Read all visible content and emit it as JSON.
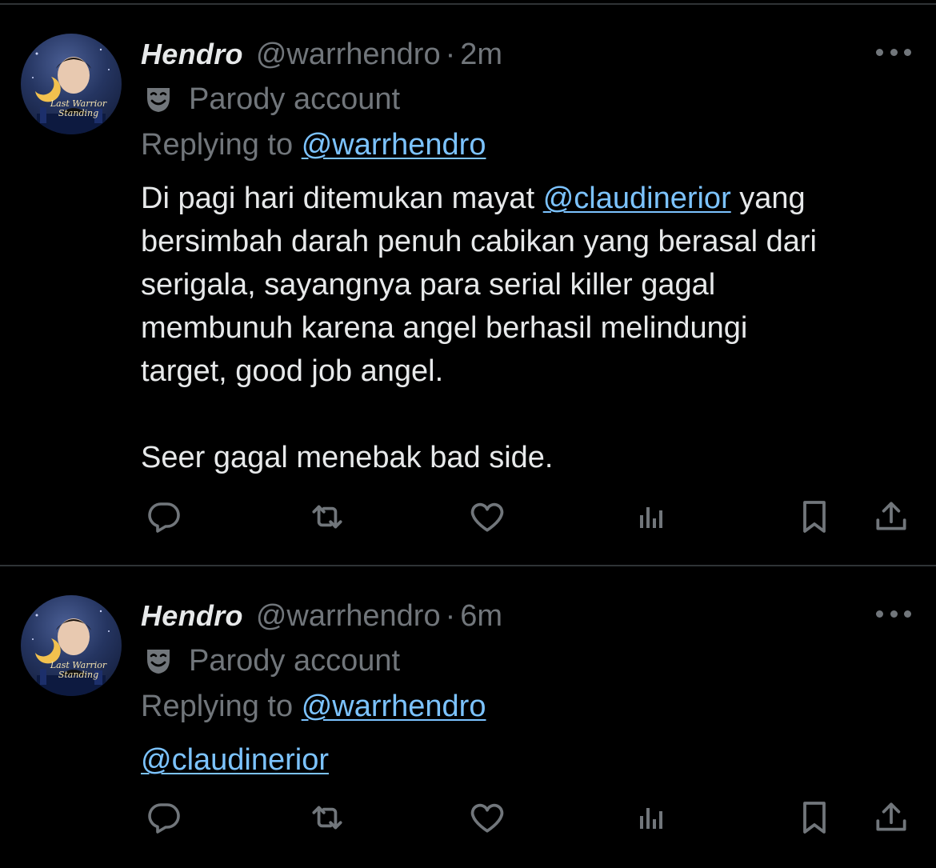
{
  "tweets": [
    {
      "author_name": "Hendro",
      "author_handle": "@warrhendro",
      "time": "2m",
      "parody_label": "Parody account",
      "replying_prefix": "Replying to",
      "replying_to": "@warrhendro",
      "body": {
        "line1_a": "Di pagi hari ditemukan mayat",
        "line1_mention": "@claudinerior",
        "line1_b": "yang",
        "line2": "bersimbah darah penuh cabikan yang berasal dari",
        "line3": "serigala, sayangnya para serial killer gagal",
        "line4": "membunuh karena angel berhasil melindungi",
        "line5": "target, good job angel.",
        "line6": "Seer gagal menebak bad side."
      },
      "avatar_text": "Last Warrior Standing"
    },
    {
      "author_name": "Hendro",
      "author_handle": "@warrhendro",
      "time": "6m",
      "parody_label": "Parody account",
      "replying_prefix": "Replying to",
      "replying_to": "@warrhendro",
      "body": {
        "mention": "@claudinerior"
      },
      "avatar_text": "Last Warrior Standing"
    }
  ],
  "icons": {
    "reply": "reply-icon",
    "retweet": "retweet-icon",
    "like": "like-icon",
    "views": "views-icon",
    "bookmark": "bookmark-icon",
    "share": "share-icon",
    "more": "more-icon",
    "parody": "parody-mask-icon"
  },
  "colors": {
    "background": "#000000",
    "text": "#e7e9ea",
    "muted": "#71767b",
    "link": "#7cc3ff",
    "divider": "#2f3336"
  }
}
